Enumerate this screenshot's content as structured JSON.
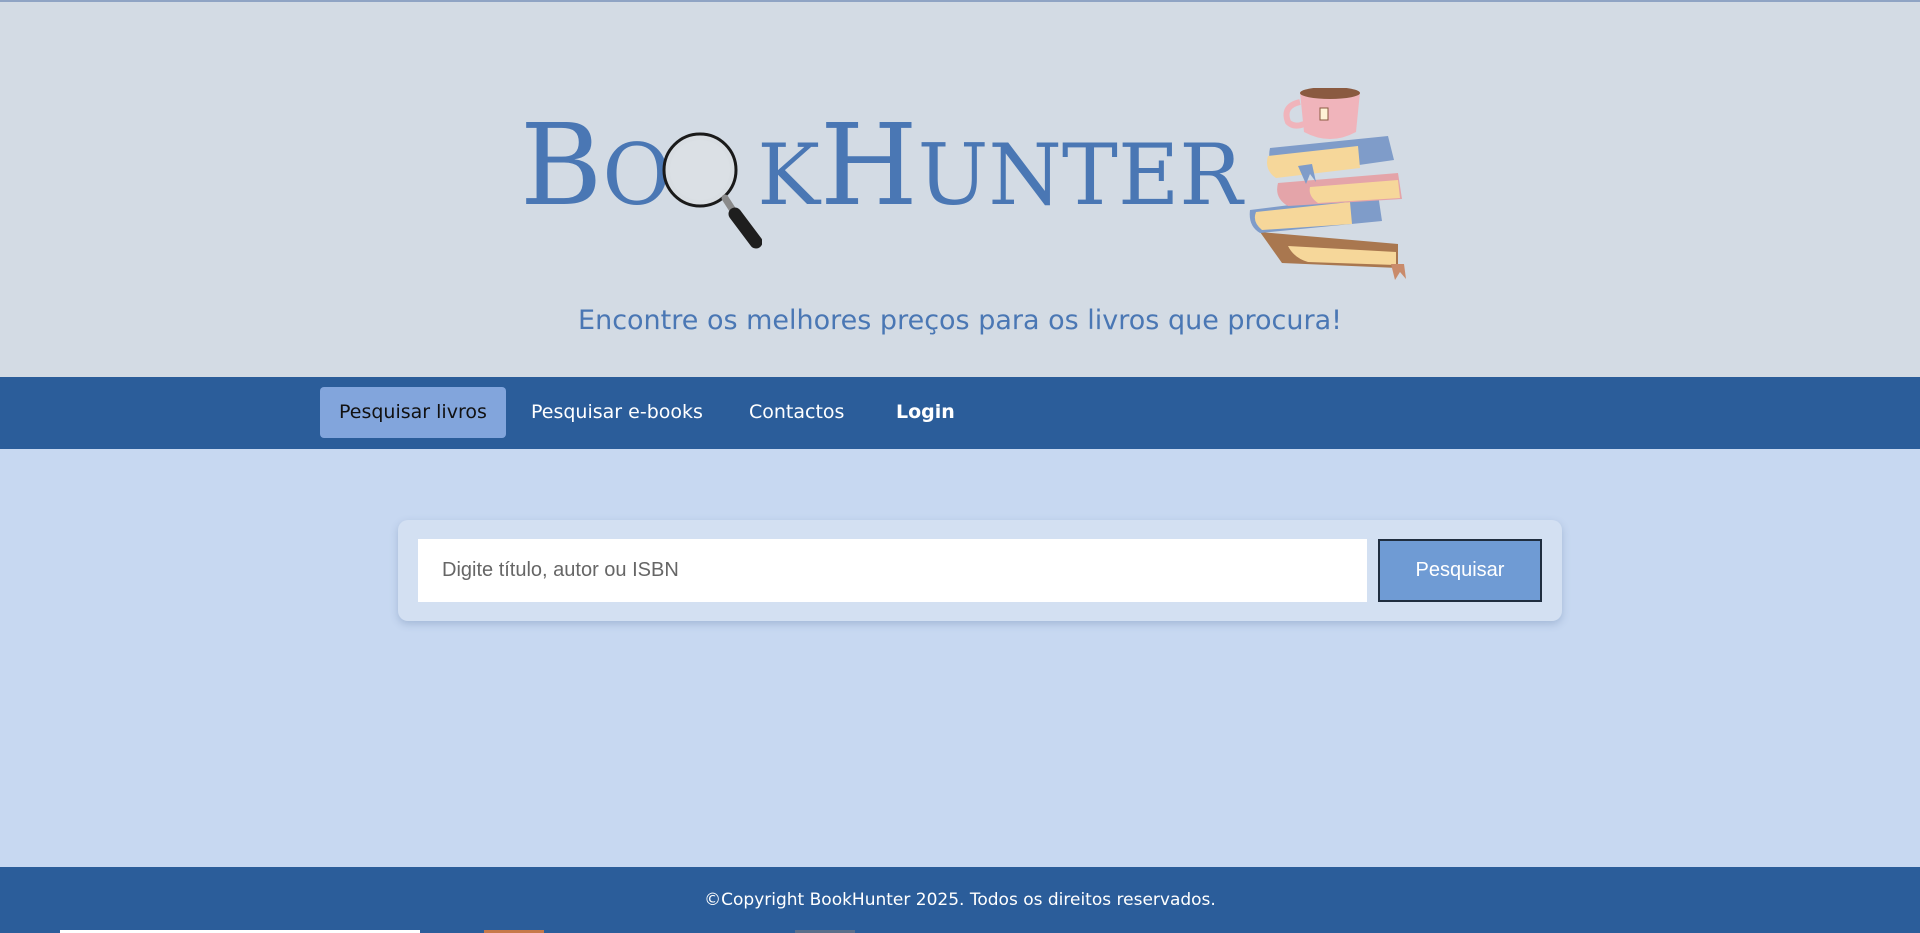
{
  "brand": {
    "logo_text": "BookHunter",
    "logo_part1": "B",
    "logo_part2": "O",
    "logo_part3": "K",
    "logo_part4": "H",
    "logo_part5": "UNTER",
    "tagline": "Encontre os melhores preços para os livros que procura!",
    "colors": {
      "header_bg": "#d3dbe4",
      "brand_blue": "#4a77b4",
      "nav_bg": "#2b5d9a",
      "nav_active": "#82a5dc",
      "page_bg": "#c7d8f1",
      "button_bg": "#6f9bd4"
    }
  },
  "nav": {
    "items": [
      {
        "label": "Pesquisar livros",
        "active": true
      },
      {
        "label": "Pesquisar e-books",
        "active": false
      },
      {
        "label": "Contactos",
        "active": false
      },
      {
        "label": "Login",
        "active": false
      }
    ]
  },
  "search": {
    "placeholder": "Digite título, autor ou ISBN",
    "value": "",
    "button_label": "Pesquisar"
  },
  "footer": {
    "text": "©Copyright BookHunter 2025. Todos os direitos reservados."
  }
}
